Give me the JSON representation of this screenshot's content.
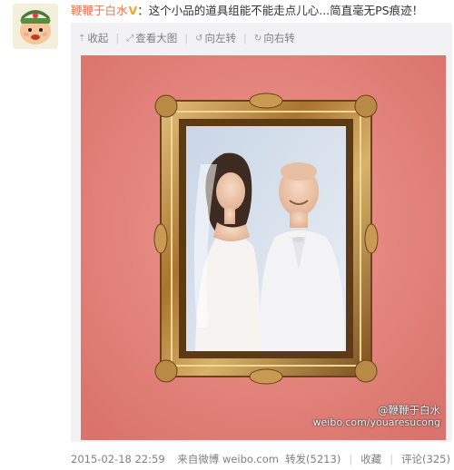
{
  "post": {
    "author": "鞭鞭于白水",
    "separator": "：",
    "text": "这个小品的道具组能不能走点儿心...简直毫无PS痕迹！"
  },
  "media_toolbar": {
    "collapse": "收起",
    "view_large": "查看大图",
    "rotate_left": "向左转",
    "rotate_right": "向右转"
  },
  "watermark": {
    "handle": "@鞭鞭于白水",
    "url": "weibo.com/youaresucong"
  },
  "footer": {
    "timestamp": "2015-02-18 22:59",
    "source_prefix": "来自",
    "source": "微博 weibo.com",
    "repost": "转发(5213)",
    "favorite": "收藏",
    "comment": "评论(325)"
  },
  "colors": {
    "author_link": "#eb7350",
    "verified_badge": "#f5a623",
    "muted_text": "#808080",
    "photo_wall": "#e8807a"
  }
}
